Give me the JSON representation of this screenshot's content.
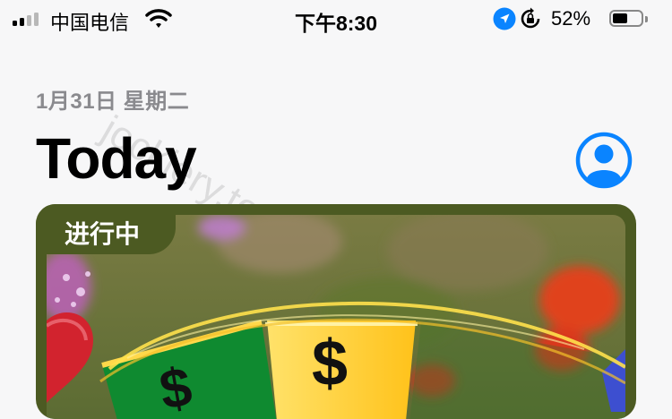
{
  "status_bar": {
    "carrier": "中国电信",
    "time": "下午8:30",
    "battery_percent": "52%",
    "battery_level": 0.52,
    "icons": [
      "signal-icon",
      "wifi-icon",
      "location-arrow-icon",
      "orientation-lock-icon",
      "battery-icon"
    ]
  },
  "header": {
    "date": "1月31日 星期二",
    "title": "Today",
    "account_icon": "person-circle-icon"
  },
  "watermark": "jockiery.top",
  "featured_card": {
    "badge": "进行中",
    "colors": {
      "frame": "#4c5a22",
      "accent": "#0a84ff"
    }
  }
}
